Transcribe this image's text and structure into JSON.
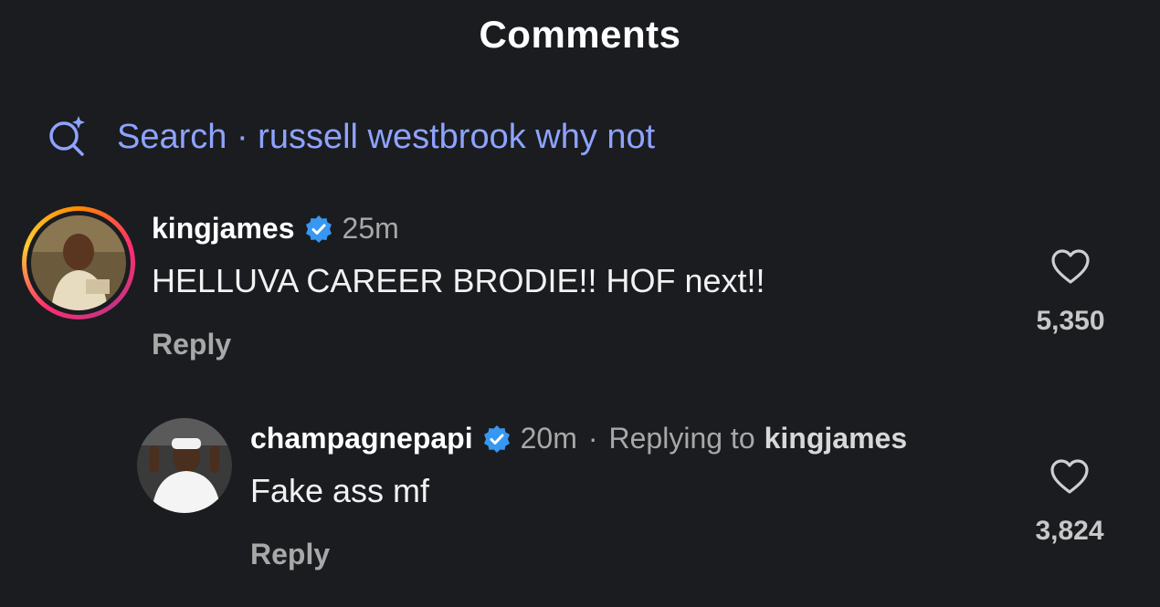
{
  "header": {
    "title": "Comments"
  },
  "search": {
    "label": "Search · russell westbrook why not",
    "icon": "sparkle-search-icon",
    "color": "#8ea3ff"
  },
  "comments": [
    {
      "username": "kingjames",
      "verified": true,
      "time": "25m",
      "text": "HELLUVA CAREER BRODIE!! HOF next!!",
      "reply_label": "Reply",
      "likes": "5,350",
      "has_story_ring": true
    },
    {
      "username": "champagnepapi",
      "verified": true,
      "time": "20m",
      "separator": "·",
      "replying_label": "Replying to",
      "replying_to": "kingjames",
      "text": "Fake ass mf",
      "reply_label": "Reply",
      "likes": "3,824"
    }
  ],
  "colors": {
    "background": "#1a1c20",
    "verified": "#3897f0",
    "secondary_text": "#a8a8a8"
  }
}
